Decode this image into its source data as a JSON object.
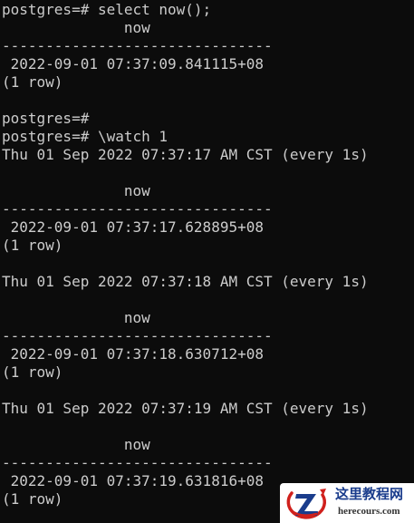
{
  "terminal": {
    "lines": [
      "postgres=# select now();",
      "              now",
      "-------------------------------",
      " 2022-09-01 07:37:09.841115+08",
      "(1 row)",
      "",
      "postgres=#",
      "postgres=# \\watch 1",
      "Thu 01 Sep 2022 07:37:17 AM CST (every 1s)",
      "",
      "              now",
      "-------------------------------",
      " 2022-09-01 07:37:17.628895+08",
      "(1 row)",
      "",
      "Thu 01 Sep 2022 07:37:18 AM CST (every 1s)",
      "",
      "              now",
      "-------------------------------",
      " 2022-09-01 07:37:18.630712+08",
      "(1 row)",
      "",
      "Thu 01 Sep 2022 07:37:19 AM CST (every 1s)",
      "",
      "              now",
      "-------------------------------",
      " 2022-09-01 07:37:19.631816+08",
      "(1 row)",
      ""
    ]
  },
  "watermark": {
    "title": "这里教程网",
    "domain": "herecours.com",
    "logo_icon": "z-logo-icon",
    "colors": {
      "blue": "#1a3c8c",
      "red": "#d0201c"
    }
  },
  "colors": {
    "background": "#0c0c0c",
    "text": "#cccccc"
  }
}
